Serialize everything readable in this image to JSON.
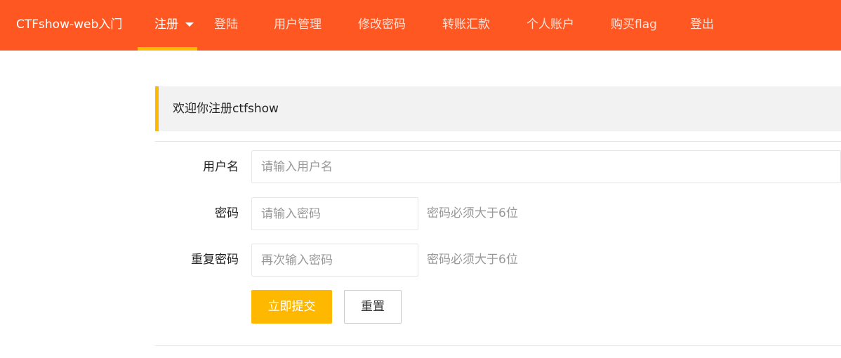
{
  "brand": "CTFshow-web入门",
  "nav": {
    "items": [
      {
        "label": "注册"
      },
      {
        "label": "登陆"
      },
      {
        "label": "用户管理"
      },
      {
        "label": "修改密码"
      },
      {
        "label": "转账汇款"
      },
      {
        "label": "个人账户"
      },
      {
        "label": "购买flag"
      },
      {
        "label": "登出"
      }
    ],
    "active": "注册"
  },
  "colors": {
    "nav_bg": "#ff5722",
    "accent": "#ffb800",
    "quote_bg": "#f2f2f2"
  },
  "form": {
    "welcome": "欢迎你注册ctfshow",
    "username": {
      "label": "用户名",
      "placeholder": "请输入用户名",
      "value": ""
    },
    "password": {
      "label": "密码",
      "placeholder": "请输入密码",
      "value": "",
      "hint": "密码必须大于6位"
    },
    "repassword": {
      "label": "重复密码",
      "placeholder": "再次输入密码",
      "value": "",
      "hint": "密码必须大于6位"
    },
    "submit_label": "立即提交",
    "reset_label": "重置"
  }
}
